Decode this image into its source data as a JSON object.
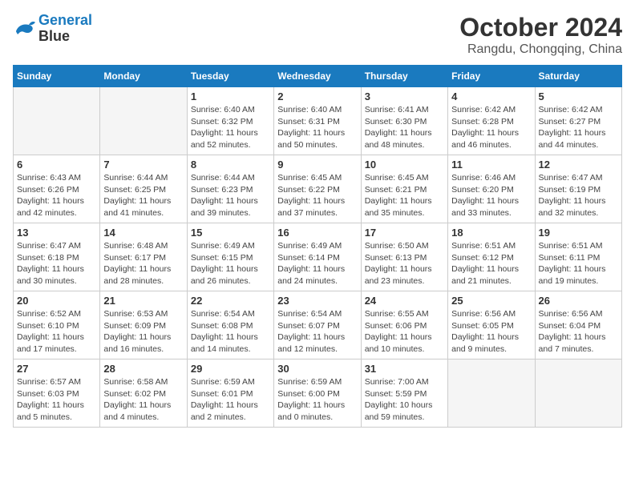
{
  "header": {
    "logo_line1": "General",
    "logo_line2": "Blue",
    "month_title": "October 2024",
    "location": "Rangdu, Chongqing, China"
  },
  "days_of_week": [
    "Sunday",
    "Monday",
    "Tuesday",
    "Wednesday",
    "Thursday",
    "Friday",
    "Saturday"
  ],
  "weeks": [
    [
      {
        "day": "",
        "info": ""
      },
      {
        "day": "",
        "info": ""
      },
      {
        "day": "1",
        "info": "Sunrise: 6:40 AM\nSunset: 6:32 PM\nDaylight: 11 hours\nand 52 minutes."
      },
      {
        "day": "2",
        "info": "Sunrise: 6:40 AM\nSunset: 6:31 PM\nDaylight: 11 hours\nand 50 minutes."
      },
      {
        "day": "3",
        "info": "Sunrise: 6:41 AM\nSunset: 6:30 PM\nDaylight: 11 hours\nand 48 minutes."
      },
      {
        "day": "4",
        "info": "Sunrise: 6:42 AM\nSunset: 6:28 PM\nDaylight: 11 hours\nand 46 minutes."
      },
      {
        "day": "5",
        "info": "Sunrise: 6:42 AM\nSunset: 6:27 PM\nDaylight: 11 hours\nand 44 minutes."
      }
    ],
    [
      {
        "day": "6",
        "info": "Sunrise: 6:43 AM\nSunset: 6:26 PM\nDaylight: 11 hours\nand 42 minutes."
      },
      {
        "day": "7",
        "info": "Sunrise: 6:44 AM\nSunset: 6:25 PM\nDaylight: 11 hours\nand 41 minutes."
      },
      {
        "day": "8",
        "info": "Sunrise: 6:44 AM\nSunset: 6:23 PM\nDaylight: 11 hours\nand 39 minutes."
      },
      {
        "day": "9",
        "info": "Sunrise: 6:45 AM\nSunset: 6:22 PM\nDaylight: 11 hours\nand 37 minutes."
      },
      {
        "day": "10",
        "info": "Sunrise: 6:45 AM\nSunset: 6:21 PM\nDaylight: 11 hours\nand 35 minutes."
      },
      {
        "day": "11",
        "info": "Sunrise: 6:46 AM\nSunset: 6:20 PM\nDaylight: 11 hours\nand 33 minutes."
      },
      {
        "day": "12",
        "info": "Sunrise: 6:47 AM\nSunset: 6:19 PM\nDaylight: 11 hours\nand 32 minutes."
      }
    ],
    [
      {
        "day": "13",
        "info": "Sunrise: 6:47 AM\nSunset: 6:18 PM\nDaylight: 11 hours\nand 30 minutes."
      },
      {
        "day": "14",
        "info": "Sunrise: 6:48 AM\nSunset: 6:17 PM\nDaylight: 11 hours\nand 28 minutes."
      },
      {
        "day": "15",
        "info": "Sunrise: 6:49 AM\nSunset: 6:15 PM\nDaylight: 11 hours\nand 26 minutes."
      },
      {
        "day": "16",
        "info": "Sunrise: 6:49 AM\nSunset: 6:14 PM\nDaylight: 11 hours\nand 24 minutes."
      },
      {
        "day": "17",
        "info": "Sunrise: 6:50 AM\nSunset: 6:13 PM\nDaylight: 11 hours\nand 23 minutes."
      },
      {
        "day": "18",
        "info": "Sunrise: 6:51 AM\nSunset: 6:12 PM\nDaylight: 11 hours\nand 21 minutes."
      },
      {
        "day": "19",
        "info": "Sunrise: 6:51 AM\nSunset: 6:11 PM\nDaylight: 11 hours\nand 19 minutes."
      }
    ],
    [
      {
        "day": "20",
        "info": "Sunrise: 6:52 AM\nSunset: 6:10 PM\nDaylight: 11 hours\nand 17 minutes."
      },
      {
        "day": "21",
        "info": "Sunrise: 6:53 AM\nSunset: 6:09 PM\nDaylight: 11 hours\nand 16 minutes."
      },
      {
        "day": "22",
        "info": "Sunrise: 6:54 AM\nSunset: 6:08 PM\nDaylight: 11 hours\nand 14 minutes."
      },
      {
        "day": "23",
        "info": "Sunrise: 6:54 AM\nSunset: 6:07 PM\nDaylight: 11 hours\nand 12 minutes."
      },
      {
        "day": "24",
        "info": "Sunrise: 6:55 AM\nSunset: 6:06 PM\nDaylight: 11 hours\nand 10 minutes."
      },
      {
        "day": "25",
        "info": "Sunrise: 6:56 AM\nSunset: 6:05 PM\nDaylight: 11 hours\nand 9 minutes."
      },
      {
        "day": "26",
        "info": "Sunrise: 6:56 AM\nSunset: 6:04 PM\nDaylight: 11 hours\nand 7 minutes."
      }
    ],
    [
      {
        "day": "27",
        "info": "Sunrise: 6:57 AM\nSunset: 6:03 PM\nDaylight: 11 hours\nand 5 minutes."
      },
      {
        "day": "28",
        "info": "Sunrise: 6:58 AM\nSunset: 6:02 PM\nDaylight: 11 hours\nand 4 minutes."
      },
      {
        "day": "29",
        "info": "Sunrise: 6:59 AM\nSunset: 6:01 PM\nDaylight: 11 hours\nand 2 minutes."
      },
      {
        "day": "30",
        "info": "Sunrise: 6:59 AM\nSunset: 6:00 PM\nDaylight: 11 hours\nand 0 minutes."
      },
      {
        "day": "31",
        "info": "Sunrise: 7:00 AM\nSunset: 5:59 PM\nDaylight: 10 hours\nand 59 minutes."
      },
      {
        "day": "",
        "info": ""
      },
      {
        "day": "",
        "info": ""
      }
    ]
  ]
}
